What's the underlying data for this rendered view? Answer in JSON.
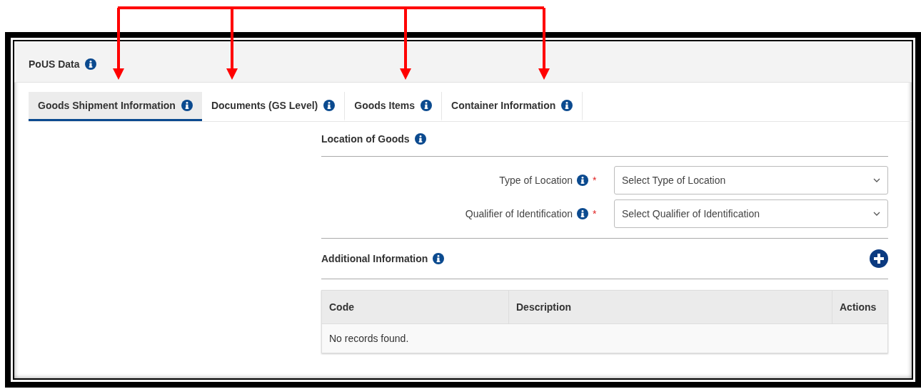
{
  "panel": {
    "title": "PoUS Data"
  },
  "tabs": [
    {
      "label": "Goods Shipment Information",
      "selected": true
    },
    {
      "label": "Documents (GS Level)",
      "selected": false
    },
    {
      "label": "Goods Items",
      "selected": false
    },
    {
      "label": "Container Information",
      "selected": false
    }
  ],
  "location_section": {
    "title": "Location of Goods",
    "fields": [
      {
        "label": "Type of Location",
        "required": true,
        "required_mark": "*",
        "placeholder": "Select Type of Location"
      },
      {
        "label": "Qualifier of Identification",
        "required": true,
        "required_mark": "*",
        "placeholder": "Select Qualifier of Identification"
      }
    ]
  },
  "additional_section": {
    "title": "Additional Information",
    "table": {
      "columns": [
        "Code",
        "Description",
        "Actions"
      ],
      "empty_message": "No records found."
    }
  }
}
